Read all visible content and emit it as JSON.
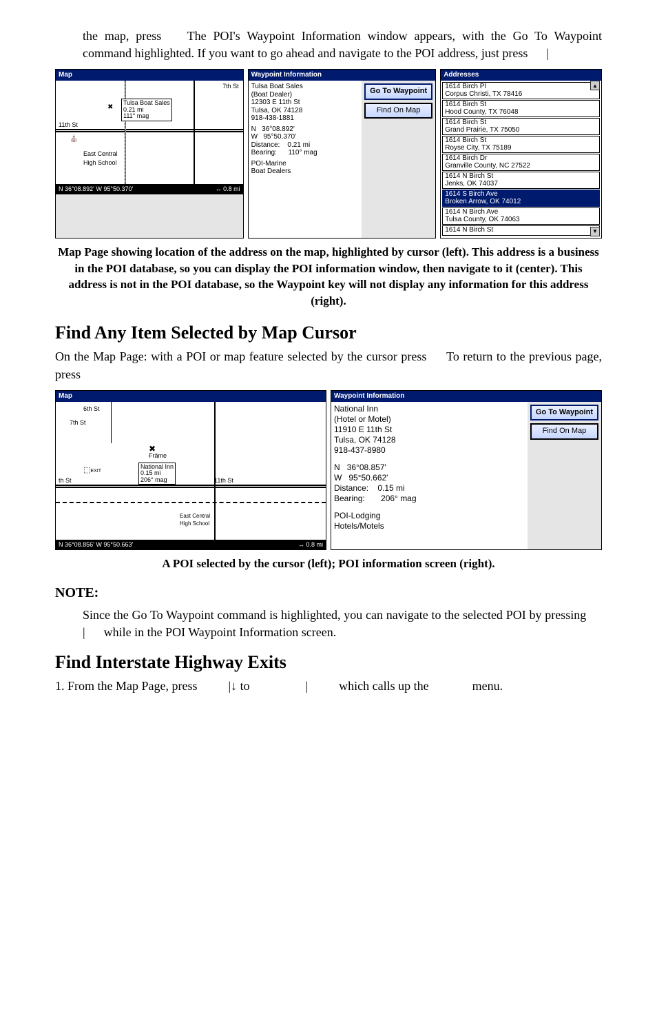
{
  "intro_text": "the map, press   The POI's Waypoint Information window appears, with the Go To Waypoint command highlighted. If you want to go ahead and navigate to the POI address, just press   |",
  "fig1": {
    "map_panel": {
      "title": "Map",
      "cursor_box": "Tulsa Boat Sales\n0.21 mi\n111° mag",
      "streets": {
        "s11": "11th St",
        "s7": "7th St"
      },
      "status_left": "N   36°08.892'    W   95°50.370'",
      "status_right": "↔   0.8 mi"
    },
    "wpt_panel": {
      "title": "Waypoint Information",
      "lines": "Tulsa Boat Sales\n(Boat Dealer)\n12303 E 11th St\nTulsa, OK 74128\n918-438-1881",
      "coords": "N   36°08.892'\nW   95°50.370'\nDistance:    0.21 mi\nBearing:      110° mag",
      "poi": "POI-Marine\nBoat Dealers",
      "btn_go": "Go To Waypoint",
      "btn_find": "Find On Map"
    },
    "addr_panel": {
      "title": "Addresses",
      "items": [
        {
          "l1": "1614 Birch Pl",
          "l2": "Corpus Christi, TX  78416",
          "sel": false
        },
        {
          "l1": "1614 Birch St",
          "l2": "Hood County, TX  76048",
          "sel": false
        },
        {
          "l1": "1614 Birch St",
          "l2": "Grand Prairie, TX  75050",
          "sel": false
        },
        {
          "l1": "1614 Birch St",
          "l2": "Royse City, TX  75189",
          "sel": false
        },
        {
          "l1": "1614 Birch Dr",
          "l2": "Granville County, NC 27522",
          "sel": false
        },
        {
          "l1": "1614 N Birch St",
          "l2": "Jenks, OK  74037",
          "sel": false
        },
        {
          "l1": "1614 S Birch Ave",
          "l2": "Broken Arrow, OK  74012",
          "sel": true
        },
        {
          "l1": "1614 N Birch Ave",
          "l2": "Tulsa County, OK  74063",
          "sel": false
        },
        {
          "l1": "1614 N Birch St",
          "l2": "",
          "sel": false
        }
      ]
    }
  },
  "caption1": "Map Page showing location of the address on the map, highlighted by cursor (left). This address is a business in the POI database, so you can display the POI information window, then navigate to it (center). This address is not in the POI database, so the Waypoint key will not display any information for this address (right).",
  "heading1": "Find Any Item Selected by Map Cursor",
  "para1": "On the Map Page: with a POI or map feature selected by the cursor press   To return to the previous page, press",
  "fig2": {
    "map_panel": {
      "title": "Map",
      "cursor_box": "National Inn\n0.15 mi\n206° mag",
      "streets": {
        "top1": "6th St",
        "top2": "7th St",
        "mid": "th St",
        "mid2": "11th St",
        "east": "East Central\nHigh School",
        "frame": "Främe"
      },
      "status_left": "N    36°08.856'    W    95°50.663'",
      "status_right": "↔   0.8 mi"
    },
    "wpt_panel": {
      "title": "Waypoint Information",
      "lines": "National Inn\n(Hotel or Motel)\n11910 E 11th St\nTulsa, OK 74128\n918-437-8980",
      "coords": "N   36°08.857'\nW   95°50.662'\nDistance:    0.15 mi\nBearing:       206° mag",
      "poi": "POI-Lodging\nHotels/Motels",
      "btn_go": "Go To Waypoint",
      "btn_find": "Find On Map"
    }
  },
  "caption2": "A POI selected by the cursor (left); POI information screen (right).",
  "note_label": "NOTE:",
  "note_text": "Since the Go To Waypoint command is highlighted, you can navigate to the selected POI by pressing   |   while in the POI Waypoint Information screen.",
  "heading2": "Find Interstate Highway Exits",
  "para2_line": "1. From the Map Page, press    |↓ to      |    which calls up the     menu."
}
